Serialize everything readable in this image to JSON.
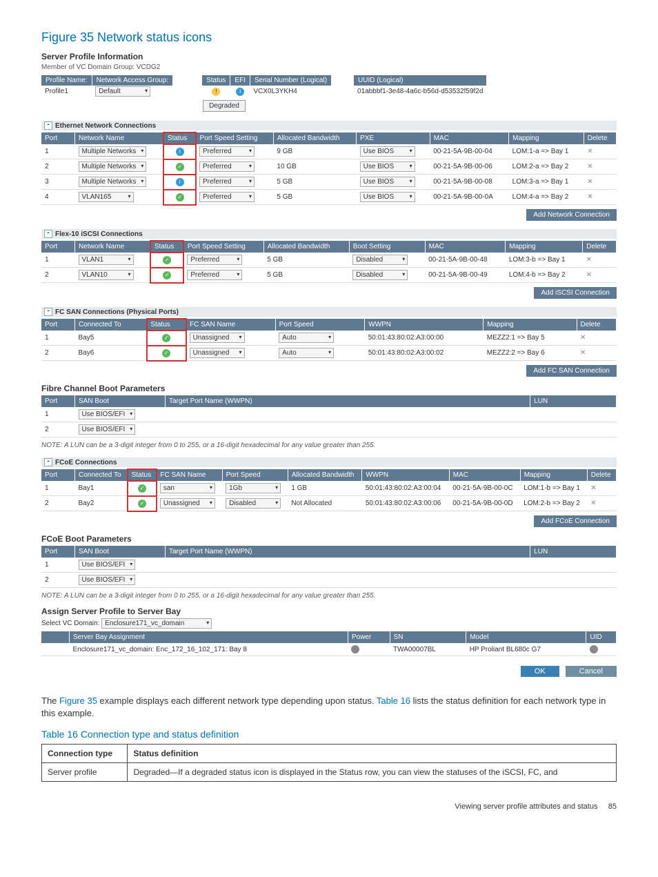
{
  "figure": {
    "title": "Figure 35 Network status icons"
  },
  "server_profile_heading": "Server Profile Information",
  "member_line": "Member of VC Domain Group: VCDG2",
  "profile_headers": {
    "profile_name": "Profile Name:",
    "network_access_group": "Network Access Group:",
    "status": "Status",
    "efi": "EFI",
    "serial_logical": "Serial Number (Logical)",
    "uuid_logical": "UUID (Logical)"
  },
  "profile_values": {
    "name": "Profile1",
    "nag": "Default",
    "serial": "VCX0L3YKH4",
    "uuid": "01abbbf1-3e48-4a6c-b56d-d53532f59f2d",
    "degraded": "Degraded"
  },
  "sections": {
    "ethernet": "Ethernet Network Connections",
    "iscsi": "Flex-10 iSCSI Connections",
    "fcsan": "FC SAN Connections (Physical Ports)",
    "fcoe": "FCoE Connections",
    "fcboot": "Fibre Channel Boot Parameters",
    "fcoeboot": "FCoE Boot Parameters",
    "assign": "Assign Server Profile to Server Bay"
  },
  "eth_headers": {
    "port": "Port",
    "network": "Network Name",
    "status": "Status",
    "pss": "Port Speed Setting",
    "alloc": "Allocated Bandwidth",
    "pxe": "PXE",
    "mac": "MAC",
    "mapping": "Mapping",
    "del": "Delete"
  },
  "eth_rows": [
    {
      "port": "1",
      "net": "Multiple Networks",
      "st": "info",
      "pss": "Preferred",
      "alloc": "9 GB",
      "pxe": "Use BIOS",
      "mac": "00-21-5A-9B-00-04",
      "map": "LOM:1-a => Bay 1"
    },
    {
      "port": "2",
      "net": "Multiple Networks",
      "st": "ok",
      "pss": "Preferred",
      "alloc": "10 GB",
      "pxe": "Use BIOS",
      "mac": "00-21-5A-9B-00-06",
      "map": "LOM:2-a => Bay 2"
    },
    {
      "port": "3",
      "net": "Multiple Networks",
      "st": "info",
      "pss": "Preferred",
      "alloc": "5 GB",
      "pxe": "Use BIOS",
      "mac": "00-21-5A-9B-00-08",
      "map": "LOM:3-a => Bay 1"
    },
    {
      "port": "4",
      "net": "VLAN165",
      "st": "ok",
      "pss": "Preferred",
      "alloc": "5 GB",
      "pxe": "Use BIOS",
      "mac": "00-21-5A-9B-00-0A",
      "map": "LOM:4-a => Bay 2"
    }
  ],
  "add_btns": {
    "network": "Add Network Connection",
    "iscsi": "Add iSCSI Connection",
    "fcsan": "Add FC SAN Connection",
    "fcoe": "Add FCoE Connection"
  },
  "iscsi_headers": {
    "port": "Port",
    "network": "Network Name",
    "status": "Status",
    "pss": "Port Speed Setting",
    "alloc": "Allocated Bandwidth",
    "boot": "Boot Setting",
    "mac": "MAC",
    "mapping": "Mapping",
    "del": "Delete"
  },
  "iscsi_rows": [
    {
      "port": "1",
      "net": "VLAN1",
      "st": "ok",
      "pss": "Preferred",
      "alloc": "5 GB",
      "boot": "Disabled",
      "mac": "00-21-5A-9B-00-48",
      "map": "LOM:3-b => Bay 1"
    },
    {
      "port": "2",
      "net": "VLAN10",
      "st": "ok",
      "pss": "Preferred",
      "alloc": "5 GB",
      "boot": "Disabled",
      "mac": "00-21-5A-9B-00-49",
      "map": "LOM:4-b => Bay 2"
    }
  ],
  "fc_headers": {
    "port": "Port",
    "conn": "Connected To",
    "status": "Status",
    "san": "FC SAN Name",
    "speed": "Port Speed",
    "wwpn": "WWPN",
    "mapping": "Mapping",
    "del": "Delete"
  },
  "fc_rows": [
    {
      "port": "1",
      "conn": "Bay5",
      "st": "ok",
      "san": "Unassigned",
      "speed": "Auto",
      "wwpn": "50:01:43:80:02:A3:00:00",
      "map": "MEZZ2:1 => Bay 5"
    },
    {
      "port": "2",
      "conn": "Bay6",
      "st": "ok",
      "san": "Unassigned",
      "speed": "Auto",
      "wwpn": "50:01:43:80:02:A3:00:02",
      "map": "MEZZ2:2 => Bay 6"
    }
  ],
  "boot_headers": {
    "port": "Port",
    "san": "SAN Boot",
    "target": "Target Port Name (WWPN)",
    "lun": "LUN"
  },
  "fcboot_rows": [
    {
      "port": "1",
      "san": "Use BIOS/EFI"
    },
    {
      "port": "2",
      "san": "Use BIOS/EFI"
    }
  ],
  "lun_note": "NOTE: A LUN can be a 3-digit integer from 0 to 255, or a 16-digit hexadecimal for any value greater than 255.",
  "fcoe_headers": {
    "port": "Port",
    "conn": "Connected To",
    "status": "Status",
    "san": "FC SAN Name",
    "pspeed": "Port Speed",
    "alloc": "Allocated Bandwidth",
    "wwpn": "WWPN",
    "mac": "MAC",
    "mapping": "Mapping",
    "del": "Delete"
  },
  "fcoe_rows": [
    {
      "port": "1",
      "conn": "Bay1",
      "st": "ok",
      "san": "san",
      "speed": "1Gb",
      "alloc": "1 GB",
      "wwpn": "50:01:43:80:02:A3:00:04",
      "mac": "00-21-5A-9B-00-0C",
      "map": "LOM:1-b => Bay 1"
    },
    {
      "port": "2",
      "conn": "Bay2",
      "st": "ok",
      "san": "Unassigned",
      "speed": "Disabled",
      "alloc": "Not Allocated",
      "wwpn": "50:01:43:80:02:A3:00:06",
      "mac": "00-21-5A-9B-00-0D",
      "map": "LOM:2-b => Bay 2"
    }
  ],
  "fcoeboot_rows": [
    {
      "port": "1",
      "san": "Use BIOS/EFI"
    },
    {
      "port": "2",
      "san": "Use BIOS/EFI"
    }
  ],
  "assign": {
    "select_label": "Select VC Domain:",
    "select_value": "Enclosure171_vc_domain",
    "hdr_sba": "Server Bay Assignment",
    "hdr_power": "Power",
    "hdr_sn": "SN",
    "hdr_model": "Model",
    "hdr_uid": "UID",
    "sba": "Enclosure171_vc_domain: Enc_172_16_102_171: Bay 8",
    "sn": "TWA00007BL",
    "model": "HP Proliant BL680c G7"
  },
  "buttons": {
    "ok": "OK",
    "cancel": "Cancel"
  },
  "body_para_pre": "The ",
  "body_para_link1": "Figure 35",
  "body_para_mid": " example displays each different network type depending upon status. ",
  "body_para_link2": "Table 16",
  "body_para_post": " lists the status definition for each network type in this example.",
  "table16_title": "Table 16 Connection type and status definition",
  "table16_h1": "Connection type",
  "table16_h2": "Status definition",
  "table16_r1c1": "Server profile",
  "table16_r1c2": "Degraded—If a degraded status icon is displayed in the Status row, you can view the statuses of the iSCSI, FC, and",
  "footer": "Viewing server profile attributes and status",
  "page": "85"
}
